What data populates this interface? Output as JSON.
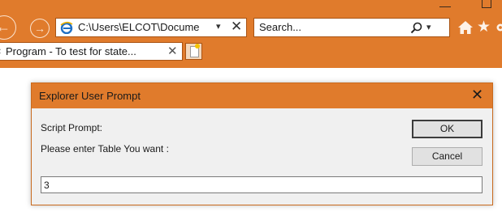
{
  "browser": {
    "address": "C:\\Users\\ELCOT\\Docume",
    "search_placeholder": "Search...",
    "tab_label": "Program - To test for state...",
    "colors": {
      "chrome": "#e07b2c",
      "dialog_title": "#e07b2c"
    },
    "icons": [
      "back-icon",
      "forward-icon",
      "ie-logo-icon",
      "dropdown-icon",
      "close-icon",
      "search-icon",
      "home-icon",
      "star-icon",
      "gear-icon",
      "new-tab-icon"
    ]
  },
  "dialog": {
    "title": "Explorer User Prompt",
    "prompt_label": "Script Prompt:",
    "message": "Please enter Table You want :",
    "ok_label": "OK",
    "cancel_label": "Cancel",
    "input_value": "3"
  }
}
